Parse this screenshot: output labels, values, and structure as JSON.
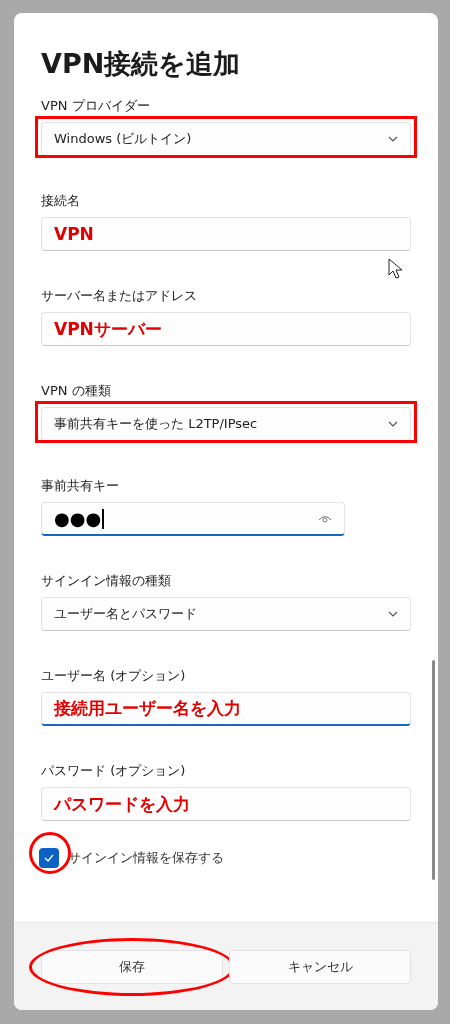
{
  "dialog": {
    "title": "VPN接続を追加",
    "fields": [
      {
        "label": "VPN プロバイダー",
        "kind": "dropdown",
        "value": "Windows (ビルトイン)",
        "highlighted": true,
        "focused": false
      },
      {
        "label": "接続名",
        "kind": "text",
        "value": "VPN",
        "highlighted": false,
        "focused": false
      },
      {
        "label": "サーバー名またはアドレス",
        "kind": "text",
        "value": "VPNサーバー",
        "highlighted": false,
        "focused": false
      },
      {
        "label": "VPN の種類",
        "kind": "dropdown",
        "value": "事前共有キーを使った L2TP/IPsec",
        "highlighted": true,
        "focused": false
      },
      {
        "label": "事前共有キー",
        "kind": "password",
        "value": "●●●",
        "highlighted": false,
        "focused": true
      },
      {
        "label": "サインイン情報の種類",
        "kind": "dropdown",
        "value": "ユーザー名とパスワード",
        "highlighted": false,
        "focused": false
      },
      {
        "label": "ユーザー名 (オプション)",
        "kind": "text",
        "value": "接続用ユーザー名を入力",
        "highlighted": false,
        "focused": true
      },
      {
        "label": "パスワード (オプション)",
        "kind": "text",
        "value": "パスワードを入力",
        "highlighted": false,
        "focused": false
      }
    ],
    "remember": {
      "label": "サインイン情報を保存する",
      "checked": true,
      "circled": true
    },
    "buttons": [
      {
        "label": "保存",
        "circled": true
      },
      {
        "label": "キャンセル",
        "circled": false
      }
    ]
  }
}
